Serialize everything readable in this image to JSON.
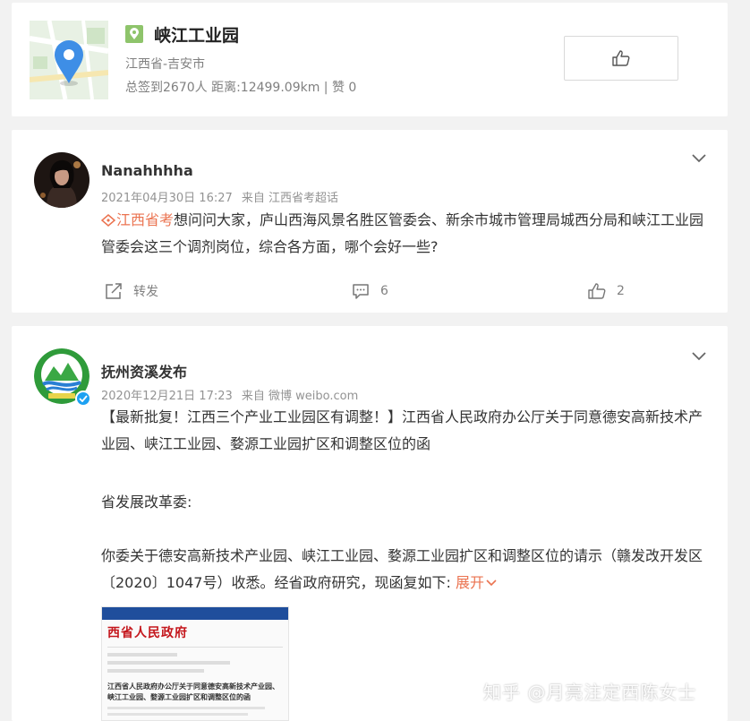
{
  "location": {
    "title": "峡江工业园",
    "region": "江西省-吉安市",
    "stats": "总签到2670人 距离:12499.09km | 赞 0"
  },
  "post1": {
    "username": "Nanahhhha",
    "datetime": "2021年04月30日 16:27",
    "source": "来自 江西省考超话",
    "topic": "江西省考",
    "text": "想问问大家，庐山西海风景名胜区管委会、新余市城市管理局城西分局和峡江工业园管委会这三个调剂岗位，综合各方面，哪个会好一些?",
    "repost_label": "转发",
    "comment_count": "6",
    "like_count": "2"
  },
  "post2": {
    "username": "抚州资溪发布",
    "datetime": "2020年12月21日 17:23",
    "source": "来自 微博 weibo.com",
    "para1": "【最新批复！江西三个产业工业园区有调整！】江西省人民政府办公厅关于同意德安高新技术产业园、峡江工业园、婺源工业园扩区和调整区位的函",
    "para2": "省发展改革委:",
    "para3": "你委关于德安高新技术产业园、峡江工业园、婺源工业园扩区和调整区位的请示（赣发改开发区〔2020〕1047号）收悉。经省政府研究，现函复如下:",
    "expand_label": "展开",
    "doc_header": "西省人民政府",
    "doc_title": "江西省人民政府办公厅关于同意德安高新技术产业园、峡江工业园、婺源工业园扩区和调整区位的函"
  },
  "watermark": "知乎 @月亮注定西陈女士",
  "colors": {
    "accent": "#eb7350",
    "page_bg": "#f2f2f2",
    "badge_green": "#8ec46b",
    "verified_blue": "#1da1f2"
  }
}
